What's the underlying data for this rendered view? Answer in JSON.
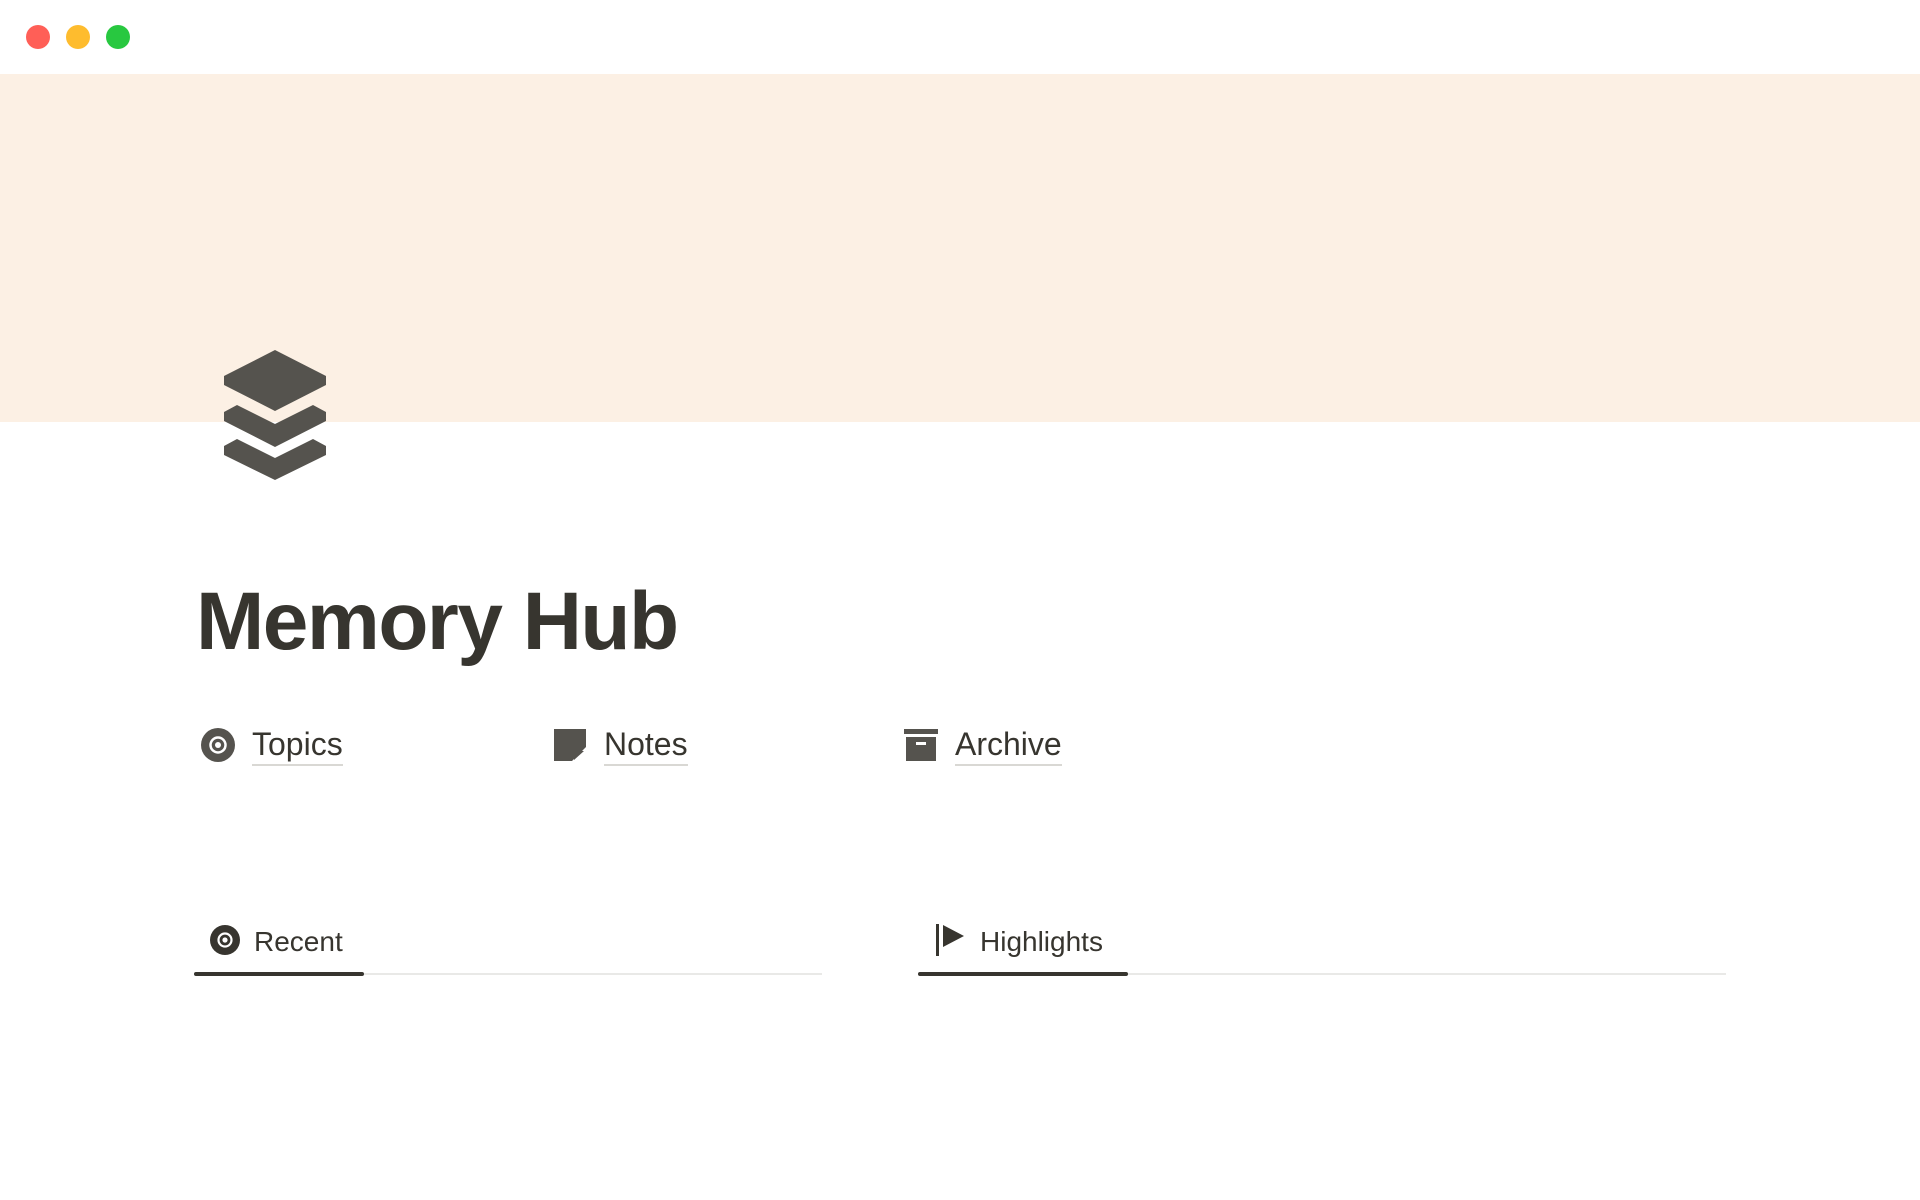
{
  "window": {
    "controls": [
      "close",
      "minimize",
      "maximize"
    ],
    "colors": {
      "close": "#ff5f57",
      "minimize": "#febc2e",
      "maximize": "#28c840"
    }
  },
  "cover": {
    "color": "#fcf0e4"
  },
  "page": {
    "icon": "layers-icon",
    "title": "Memory Hub"
  },
  "links": [
    {
      "label": "Topics",
      "icon": "target-icon"
    },
    {
      "label": "Notes",
      "icon": "note-icon"
    },
    {
      "label": "Archive",
      "icon": "archive-box-icon"
    }
  ],
  "tabs": {
    "left": {
      "label": "Recent",
      "icon": "target-icon"
    },
    "right": {
      "label": "Highlights",
      "icon": "flag-icon"
    }
  },
  "colors": {
    "text": "#37352f",
    "icon": "#55534e",
    "divider": "#e9e9e7"
  }
}
